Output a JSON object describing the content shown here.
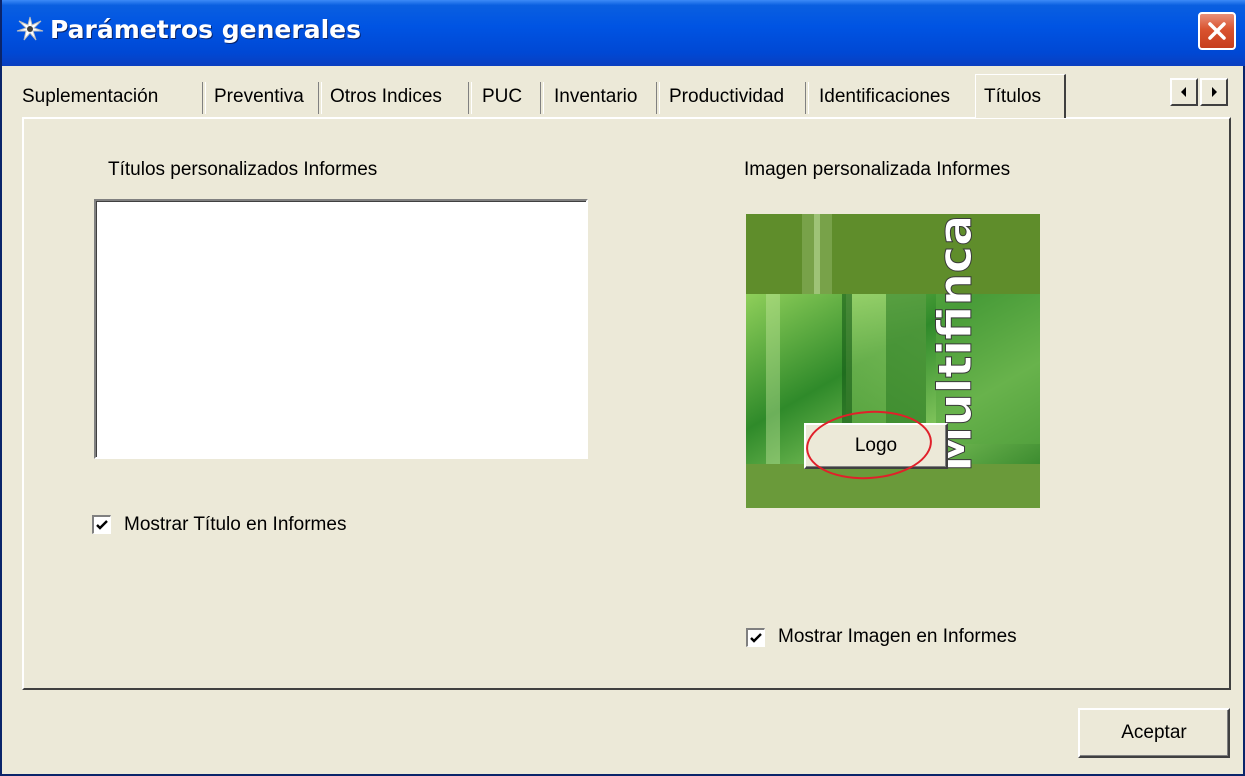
{
  "window": {
    "title": "Parámetros generales",
    "icon": "app-star-icon",
    "close_icon": "close-icon"
  },
  "tabs": [
    {
      "label": "Suplementación",
      "active": false
    },
    {
      "label": "Preventiva",
      "active": false
    },
    {
      "label": "Otros Indices",
      "active": false
    },
    {
      "label": "PUC",
      "active": false
    },
    {
      "label": "Inventario",
      "active": false
    },
    {
      "label": "Productividad",
      "active": false
    },
    {
      "label": "Identificaciones",
      "active": false
    },
    {
      "label": "Títulos",
      "active": true
    }
  ],
  "tab_scroll": {
    "left_icon": "arrow-left-icon",
    "right_icon": "arrow-right-icon"
  },
  "titles_section": {
    "label": "Títulos personalizados Informes",
    "textarea_value": "",
    "show_checkbox_label": "Mostrar Título en Informes",
    "show_checked": true
  },
  "image_section": {
    "label": "Imagen personalizada Informes",
    "logo_text": "Multifinca",
    "logo_button_label": "Logo",
    "show_checkbox_label": "Mostrar Imagen en Informes",
    "show_checked": true
  },
  "footer": {
    "accept_label": "Aceptar"
  },
  "colors": {
    "titlebar": "#0054e3",
    "dialog_bg": "#ece9d8",
    "highlight": "#e0202a",
    "logo_green": "#6a9a2a"
  }
}
